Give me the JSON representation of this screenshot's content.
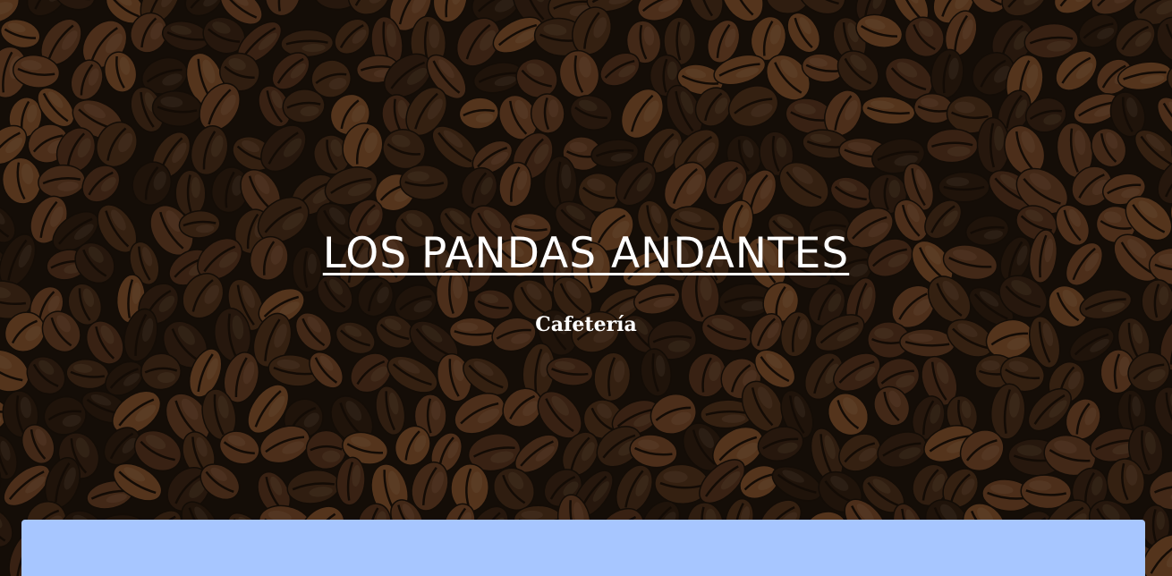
{
  "hero": {
    "title": "LOS PANDAS ANDANTES",
    "subtitle": "Cafetería",
    "background_image": "coffee-beans"
  },
  "colors": {
    "title_text": "#ffffff",
    "panel": "#a7c6ff",
    "bean_dark": "#2a1a10",
    "bean_mid": "#5a3520",
    "bean_light": "#8a5530"
  }
}
